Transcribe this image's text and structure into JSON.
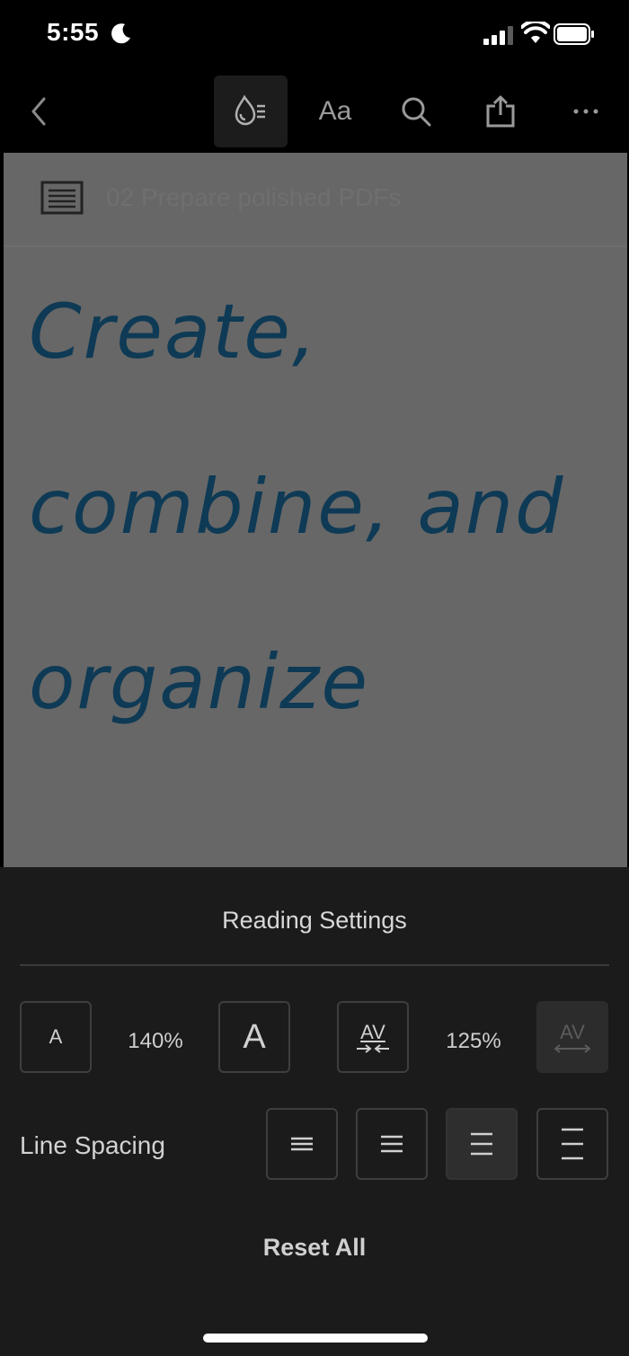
{
  "status_bar": {
    "time": "5:55"
  },
  "toolbar": {
    "font_label": "Aa"
  },
  "document": {
    "header_title": "02 Prepare polished PDFs",
    "heading_lines": [
      "Create,",
      "combine, and",
      "organize"
    ]
  },
  "reading_settings": {
    "title": "Reading Settings",
    "font_size": {
      "smaller_label": "A",
      "value": "140%",
      "larger_label": "A"
    },
    "char_spacing": {
      "decrease_label": "AV",
      "value": "125%",
      "increase_label": "AV",
      "increase_disabled": true
    },
    "line_spacing": {
      "label": "Line Spacing",
      "options_count": 4,
      "selected_index": 2
    },
    "reset_label": "Reset All"
  },
  "colors": {
    "background": "#000000",
    "document_dimmed": "#676767",
    "heading_text": "#0e3a55",
    "sheet_bg": "#1b1b1b"
  },
  "icons": [
    "moon-icon",
    "cellular-signal-icon",
    "wifi-icon",
    "battery-icon",
    "back-chevron-icon",
    "reading-mode-icon",
    "search-icon",
    "share-icon",
    "more-icon",
    "table-of-contents-icon"
  ]
}
